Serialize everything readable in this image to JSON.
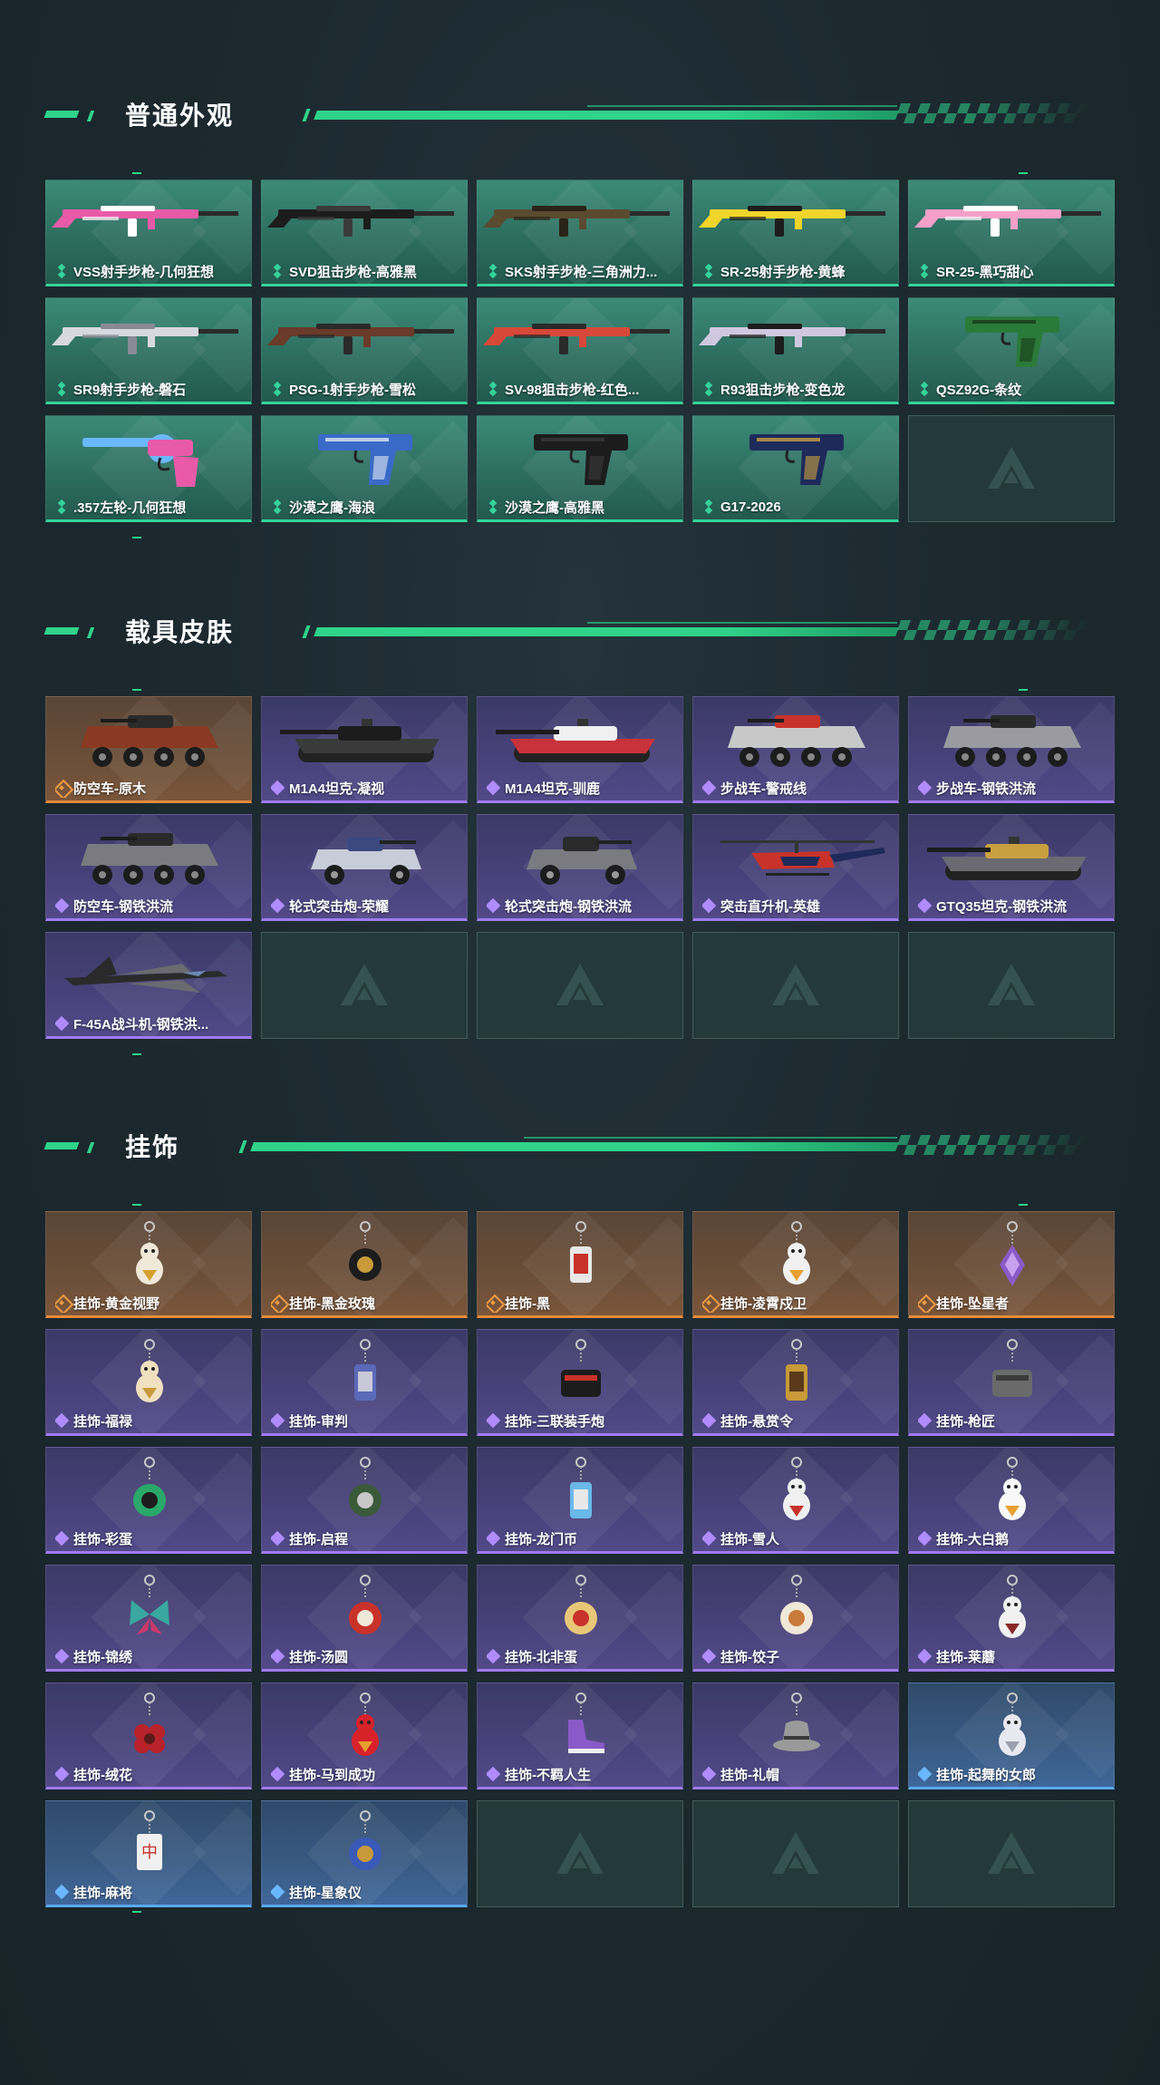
{
  "sections": [
    {
      "title": "普通外观",
      "items": [
        {
          "label": "VSS射手步枪-几何狂想",
          "rarity": "green",
          "icon": "rifle-icon",
          "colors": [
            "#e85aa8",
            "#ffffff"
          ]
        },
        {
          "label": "SVD狙击步枪-高雅黑",
          "rarity": "green",
          "icon": "rifle-icon",
          "colors": [
            "#1c1c1c",
            "#3a3a3a"
          ]
        },
        {
          "label": "SKS射手步枪-三角洲力...",
          "rarity": "green",
          "icon": "rifle-icon",
          "colors": [
            "#5a4a30",
            "#2a2418"
          ]
        },
        {
          "label": "SR-25射手步枪-黄蜂",
          "rarity": "green",
          "icon": "rifle-icon",
          "colors": [
            "#f2d52a",
            "#1c1c1c"
          ]
        },
        {
          "label": "SR-25-黑巧甜心",
          "rarity": "green",
          "icon": "rifle-icon",
          "colors": [
            "#f4a0c8",
            "#ffffff"
          ]
        },
        {
          "label": "SR9射手步枪-磐石",
          "rarity": "green",
          "icon": "rifle-icon",
          "colors": [
            "#d8d8e0",
            "#8a8a96"
          ]
        },
        {
          "label": "PSG-1射手步枪-雪松",
          "rarity": "green",
          "icon": "rifle-icon",
          "colors": [
            "#6a3a2a",
            "#2a2a2a"
          ]
        },
        {
          "label": "SV-98狙击步枪-红色...",
          "rarity": "green",
          "icon": "rifle-icon",
          "colors": [
            "#d84838",
            "#2a2a2a"
          ]
        },
        {
          "label": "R93狙击步枪-变色龙",
          "rarity": "green",
          "icon": "rifle-icon",
          "colors": [
            "#d0c8e0",
            "#1c1c1c"
          ]
        },
        {
          "label": "QSZ92G-条纹",
          "rarity": "green",
          "icon": "pistol-icon",
          "colors": [
            "#2a7a3a",
            "#1a3a1a"
          ]
        },
        {
          "label": ".357左轮-几何狂想",
          "rarity": "green",
          "icon": "revolver-icon",
          "colors": [
            "#e85aa8",
            "#6ab8ff"
          ]
        },
        {
          "label": "沙漠之鹰-海浪",
          "rarity": "green",
          "icon": "pistol-icon",
          "colors": [
            "#3a6ac8",
            "#e0e8f0"
          ]
        },
        {
          "label": "沙漠之鹰-高雅黑",
          "rarity": "green",
          "icon": "pistol-icon",
          "colors": [
            "#1c1c1c",
            "#3a3a3a"
          ]
        },
        {
          "label": "G17-2026",
          "rarity": "green",
          "icon": "pistol-icon",
          "colors": [
            "#1e2a5a",
            "#c8a040"
          ]
        },
        {
          "label": "",
          "rarity": "empty",
          "icon": "logo-icon"
        }
      ]
    },
    {
      "title": "载具皮肤",
      "items": [
        {
          "label": "防空车-原木",
          "rarity": "gold",
          "icon": "apc-icon",
          "colors": [
            "#8a3a22",
            "#2a2a2a"
          ]
        },
        {
          "label": "M1A4坦克-凝视",
          "rarity": "purple",
          "icon": "tank-icon",
          "colors": [
            "#3a3a3a",
            "#1c1c1c"
          ]
        },
        {
          "label": "M1A4坦克-驯鹿",
          "rarity": "purple",
          "icon": "tank-icon",
          "colors": [
            "#c8323a",
            "#f0f0f0"
          ]
        },
        {
          "label": "步战车-警戒线",
          "rarity": "purple",
          "icon": "apc-icon",
          "colors": [
            "#c8c8c8",
            "#c8322a"
          ]
        },
        {
          "label": "步战车-钢铁洪流",
          "rarity": "purple",
          "icon": "apc-icon",
          "colors": [
            "#9a9aa0",
            "#2a2a2a"
          ]
        },
        {
          "label": "防空车-钢铁洪流",
          "rarity": "purple",
          "icon": "apc-icon",
          "colors": [
            "#7a7a80",
            "#2a2a2a"
          ]
        },
        {
          "label": "轮式突击炮-荣耀",
          "rarity": "purple",
          "icon": "armored-car-icon",
          "colors": [
            "#c8ccd8",
            "#3a4a80"
          ]
        },
        {
          "label": "轮式突击炮-钢铁洪流",
          "rarity": "purple",
          "icon": "armored-car-icon",
          "colors": [
            "#7a7a80",
            "#2a2a2a"
          ]
        },
        {
          "label": "突击直升机-英雄",
          "rarity": "purple",
          "icon": "helicopter-icon",
          "colors": [
            "#c8322a",
            "#1e2a5a"
          ]
        },
        {
          "label": "GTQ35坦克-钢铁洪流",
          "rarity": "purple",
          "icon": "tank-icon",
          "colors": [
            "#6a6a70",
            "#c8a040"
          ]
        },
        {
          "label": "F-45A战斗机-钢铁洪...",
          "rarity": "purple",
          "icon": "jet-icon",
          "colors": [
            "#2a2a2a",
            "#6a6a70"
          ]
        },
        {
          "label": "",
          "rarity": "empty",
          "icon": "logo-icon"
        },
        {
          "label": "",
          "rarity": "empty",
          "icon": "logo-icon"
        },
        {
          "label": "",
          "rarity": "empty",
          "icon": "logo-icon"
        },
        {
          "label": "",
          "rarity": "empty",
          "icon": "logo-icon"
        }
      ]
    },
    {
      "title": "挂饰",
      "items": [
        {
          "label": "挂饰-黄金视野",
          "rarity": "gold",
          "icon": "charm-figure-icon",
          "colors": [
            "#f0e8d8",
            "#d4a030"
          ]
        },
        {
          "label": "挂饰-黑金玫瑰",
          "rarity": "gold",
          "icon": "charm-round-icon",
          "colors": [
            "#1c1c1c",
            "#c89a3a"
          ]
        },
        {
          "label": "挂饰-黑",
          "rarity": "gold",
          "icon": "charm-tag-icon",
          "colors": [
            "#e8e8e8",
            "#c8322a"
          ]
        },
        {
          "label": "挂饰-凌霄戍卫",
          "rarity": "gold",
          "icon": "charm-figure-icon",
          "colors": [
            "#f0f0f0",
            "#e8a030"
          ]
        },
        {
          "label": "挂饰-坠星者",
          "rarity": "gold",
          "icon": "charm-crystal-icon",
          "colors": [
            "#8a5ac8",
            "#c8a0f0"
          ]
        },
        {
          "label": "挂饰-福禄",
          "rarity": "purple",
          "icon": "charm-figure-icon",
          "colors": [
            "#f0e0c0",
            "#c89a3a"
          ]
        },
        {
          "label": "挂饰-审判",
          "rarity": "purple",
          "icon": "charm-tag-icon",
          "colors": [
            "#5a6ab8",
            "#c8c8d8"
          ]
        },
        {
          "label": "挂饰-三联装手炮",
          "rarity": "purple",
          "icon": "charm-box-icon",
          "colors": [
            "#1c1c1c",
            "#c8322a"
          ]
        },
        {
          "label": "挂饰-悬赏令",
          "rarity": "purple",
          "icon": "charm-tag-icon",
          "colors": [
            "#c89a3a",
            "#5a3a1a"
          ]
        },
        {
          "label": "挂饰-枪匠",
          "rarity": "purple",
          "icon": "charm-box-icon",
          "colors": [
            "#6a6a6a",
            "#3a3a3a"
          ]
        },
        {
          "label": "挂饰-彩蛋",
          "rarity": "purple",
          "icon": "charm-round-icon",
          "colors": [
            "#2aa86a",
            "#1c1c1c"
          ]
        },
        {
          "label": "挂饰-启程",
          "rarity": "purple",
          "icon": "charm-round-icon",
          "colors": [
            "#3a5a3a",
            "#c8c8c8"
          ]
        },
        {
          "label": "挂饰-龙门币",
          "rarity": "purple",
          "icon": "charm-tag-icon",
          "colors": [
            "#6ab8e8",
            "#e8e8e8"
          ]
        },
        {
          "label": "挂饰-雪人",
          "rarity": "purple",
          "icon": "charm-figure-icon",
          "colors": [
            "#f0f0f0",
            "#c8322a"
          ]
        },
        {
          "label": "挂饰-大白鹅",
          "rarity": "purple",
          "icon": "charm-figure-icon",
          "colors": [
            "#f8f8f8",
            "#e8a030"
          ]
        },
        {
          "label": "挂饰-锦绣",
          "rarity": "purple",
          "icon": "charm-butterfly-icon",
          "colors": [
            "#3aa8a0",
            "#c83a6a"
          ]
        },
        {
          "label": "挂饰-汤圆",
          "rarity": "purple",
          "icon": "charm-round-icon",
          "colors": [
            "#c8322a",
            "#f0e8d8"
          ]
        },
        {
          "label": "挂饰-北非蛋",
          "rarity": "purple",
          "icon": "charm-round-icon",
          "colors": [
            "#e8c878",
            "#c8322a"
          ]
        },
        {
          "label": "挂饰-饺子",
          "rarity": "purple",
          "icon": "charm-round-icon",
          "colors": [
            "#f0e8d8",
            "#c87a3a"
          ]
        },
        {
          "label": "挂饰-莱蘑",
          "rarity": "purple",
          "icon": "charm-figure-icon",
          "colors": [
            "#f0f0f0",
            "#8a2a2a"
          ]
        },
        {
          "label": "挂饰-绒花",
          "rarity": "purple",
          "icon": "charm-flower-icon",
          "colors": [
            "#b8222a",
            "#5a1a1a"
          ]
        },
        {
          "label": "挂饰-马到成功",
          "rarity": "purple",
          "icon": "charm-figure-icon",
          "colors": [
            "#d8222a",
            "#e8a030"
          ]
        },
        {
          "label": "挂饰-不羁人生",
          "rarity": "purple",
          "icon": "charm-shoe-icon",
          "colors": [
            "#8a5ac8",
            "#f0f0f0"
          ]
        },
        {
          "label": "挂饰-礼帽",
          "rarity": "purple",
          "icon": "charm-hat-icon",
          "colors": [
            "#9a9a9a",
            "#3a3a3a"
          ]
        },
        {
          "label": "挂饰-起舞的女郎",
          "rarity": "blue",
          "icon": "charm-figure-icon",
          "colors": [
            "#e8e8f0",
            "#9aa0b0"
          ]
        },
        {
          "label": "挂饰-麻将",
          "rarity": "blue",
          "icon": "charm-tile-icon",
          "colors": [
            "#f0f0f0",
            "#c8322a"
          ]
        },
        {
          "label": "挂饰-星象仪",
          "rarity": "blue",
          "icon": "charm-round-icon",
          "colors": [
            "#3a5ab8",
            "#c89a3a"
          ]
        },
        {
          "label": "",
          "rarity": "empty",
          "icon": "logo-icon"
        },
        {
          "label": "",
          "rarity": "empty",
          "icon": "logo-icon"
        },
        {
          "label": "",
          "rarity": "empty",
          "icon": "logo-icon"
        }
      ]
    }
  ],
  "colors": {
    "accent": "#2fd38a",
    "green_border": "#35d39a",
    "gold_border": "#e88a3a",
    "purple_border": "#a07af0",
    "blue_border": "#58a8f0"
  }
}
